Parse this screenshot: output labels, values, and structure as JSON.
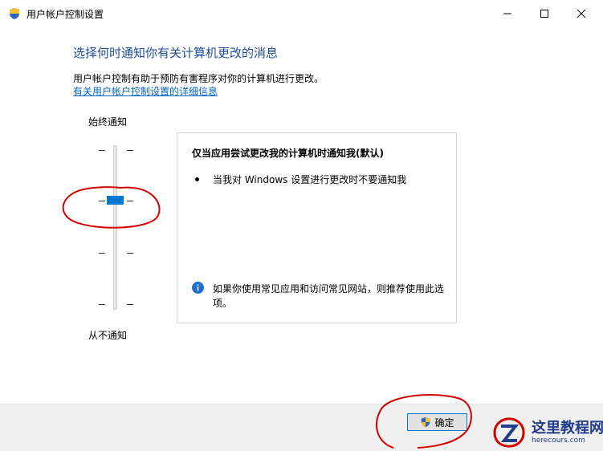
{
  "window": {
    "title": "用户帐户控制设置",
    "icon": "uac-shield-icon",
    "controls": {
      "minimize": "minimize-icon",
      "maximize": "maximize-icon",
      "close": "close-icon"
    }
  },
  "main": {
    "heading": "选择何时通知你有关计算机更改的消息",
    "description": "用户帐户控制有助于预防有害程序对你的计算机进行更改。",
    "link": "有关用户帐户控制设置的详细信息"
  },
  "slider": {
    "top_label": "始终通知",
    "bottom_label": "从不通知",
    "levels": 4,
    "selected_level": 3
  },
  "panel": {
    "title": "仅当应用尝试更改我的计算机时通知我(默认)",
    "bullets": [
      "当我对 Windows 设置进行更改时不要通知我"
    ],
    "recommendation": "如果你使用常见应用和访问常见网站，则推荐使用此选项。"
  },
  "footer": {
    "ok_label": "确定"
  },
  "watermark": {
    "title": "这里教程网",
    "url": "herecours.com"
  },
  "colors": {
    "heading": "#1e4d9b",
    "link": "#0066cc",
    "thumb": "#0078d7",
    "annotation": "#d40000"
  }
}
